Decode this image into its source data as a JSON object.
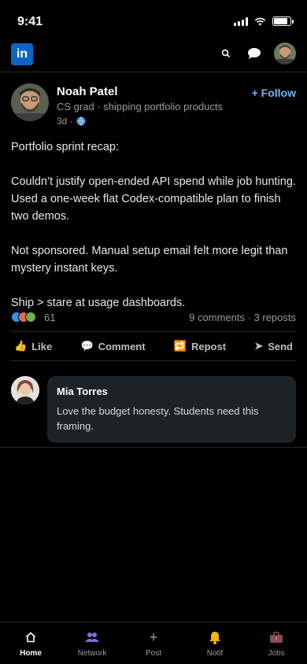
{
  "status_bar": {
    "time": "9:41"
  },
  "header": {
    "logo_text": "in",
    "icons": [
      "search-icon",
      "message-icon",
      "profile-avatar"
    ]
  },
  "post": {
    "author": {
      "name": "Noah Patel",
      "headline": "CS grad · shipping portfolio products",
      "age": "3d ·"
    },
    "follow_label": "+ Follow",
    "paragraphs": [
      "Portfolio sprint recap:",
      "Couldn’t justify open-ended API spend while job hunting. Used a one-week flat Codex-compatible plan to finish two demos.",
      "Not sponsored. Manual setup email felt more legit than mystery instant keys.",
      "Ship > stare at usage dashboards."
    ],
    "reaction_count": "61",
    "engagement": "9 comments · 3 reposts",
    "actions": [
      {
        "label": "Like",
        "icon": "👍"
      },
      {
        "label": "Comment",
        "icon": "💬"
      },
      {
        "label": "Repost",
        "icon": "🔁"
      },
      {
        "label": "Send",
        "icon": "➤"
      }
    ]
  },
  "comment": {
    "author": "Mia Torres",
    "text": "Love the budget honesty. Students need this framing."
  },
  "bottom_nav": [
    {
      "label": "Home",
      "icon": "⌂"
    },
    {
      "label": "Network",
      "icon": "👥"
    },
    {
      "label": "Post",
      "icon": "+"
    },
    {
      "label": "Notif",
      "icon": "🔔"
    },
    {
      "label": "Jobs",
      "icon": "💼"
    }
  ],
  "colors": {
    "background": "#000000",
    "accent_link": "#70b5f9",
    "brand": "#0a66c2",
    "comment_bubble": "#1d2226"
  }
}
